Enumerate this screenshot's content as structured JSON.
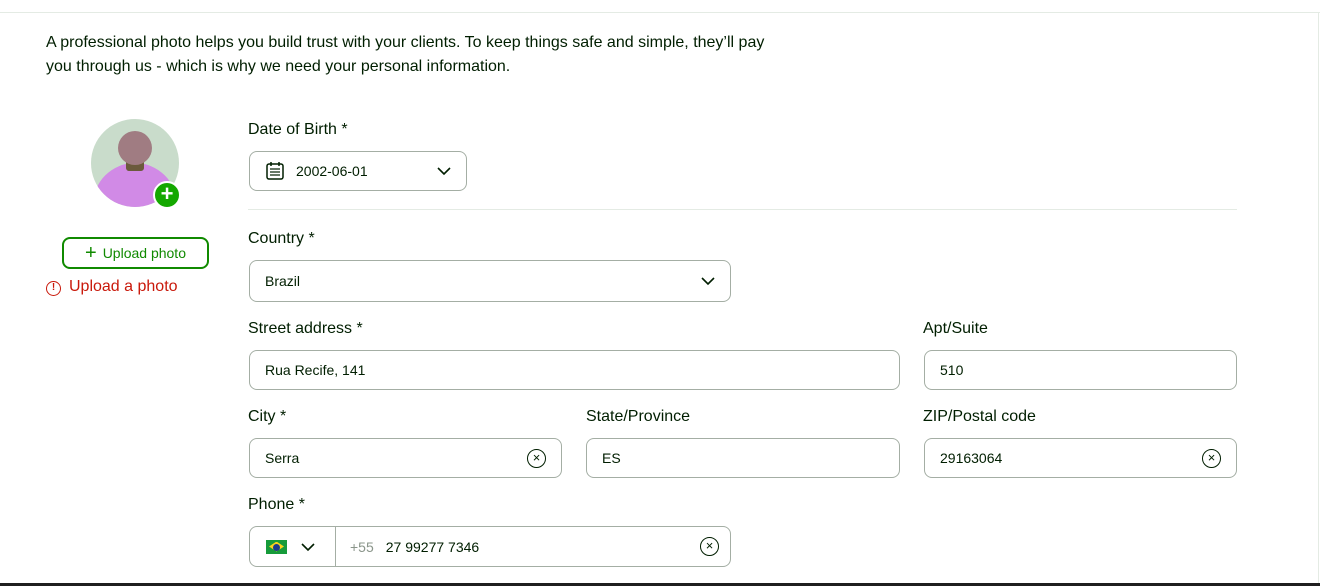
{
  "intro": {
    "text": "A professional photo helps you build trust with your clients. To keep things safe and simple, they’ll pay you through us - which is why we need your personal information."
  },
  "photo": {
    "upload_label": "Upload photo",
    "error": "Upload a photo"
  },
  "form": {
    "dob": {
      "label": "Date of Birth *",
      "value": "2002-06-01"
    },
    "country": {
      "label": "Country *",
      "value": "Brazil"
    },
    "street": {
      "label": "Street address *",
      "value": "Rua Recife, 141"
    },
    "apt": {
      "label": "Apt/Suite",
      "value": "510"
    },
    "city": {
      "label": "City *",
      "value": "Serra"
    },
    "state": {
      "label": "State/Province",
      "value": "ES"
    },
    "zip": {
      "label": "ZIP/Postal code",
      "value": "29163064"
    },
    "phone": {
      "label": "Phone *",
      "prefix": "+55",
      "value": "27 99277 7346",
      "country_flag": "brazil-flag"
    }
  },
  "colors": {
    "accent": "#108a00",
    "error": "#c9190b",
    "text": "#001e00",
    "border": "#a4aea4"
  }
}
